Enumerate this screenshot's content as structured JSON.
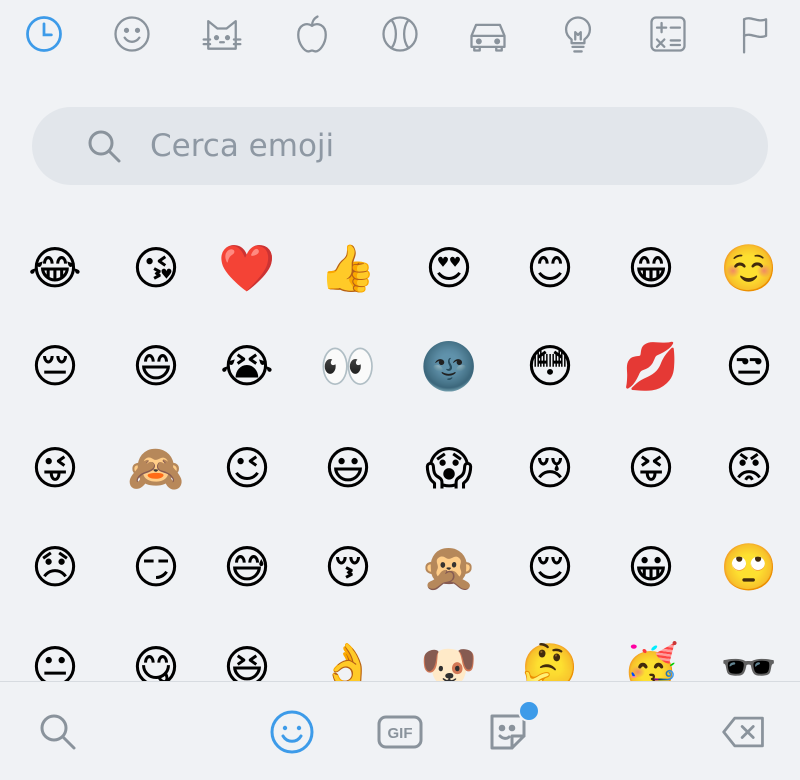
{
  "colors": {
    "accent": "#3d9be9",
    "icon_gray": "#8a939c",
    "search_bg": "#e2e6eb",
    "background": "#f0f2f5"
  },
  "categories": [
    {
      "icon": "clock-icon",
      "active": true
    },
    {
      "icon": "smiley-icon",
      "active": false
    },
    {
      "icon": "cat-icon",
      "active": false
    },
    {
      "icon": "apple-icon",
      "active": false
    },
    {
      "icon": "ball-icon",
      "active": false
    },
    {
      "icon": "car-icon",
      "active": false
    },
    {
      "icon": "lightbulb-icon",
      "active": false
    },
    {
      "icon": "symbols-icon",
      "active": false
    },
    {
      "icon": "flag-icon",
      "active": false
    }
  ],
  "search": {
    "placeholder": "Cerca emoji"
  },
  "emojis": [
    [
      "😂",
      "😘",
      "❤️",
      "👍",
      "😍",
      "😊",
      "😁",
      "☺️"
    ],
    [
      "😔",
      "😄",
      "😭",
      "👀",
      "🌚",
      "😳",
      "💋",
      "😒"
    ],
    [
      "😜",
      "🙈",
      "😉",
      "😃",
      "😱",
      "😢",
      "😝",
      "😡"
    ],
    [
      "😞",
      "😏",
      "😅",
      "😚",
      "🙊",
      "😌",
      "😀",
      "🙄"
    ],
    [
      "😐",
      "😋",
      "😆",
      "👌",
      "🐶",
      "🤔",
      "🥳",
      "🕶️"
    ]
  ],
  "bottom_bar": {
    "gif_label": "GIF",
    "items": [
      "search-icon",
      "emoji-icon",
      "gif-icon",
      "sticker-icon",
      "backspace-icon"
    ],
    "active": "emoji-icon"
  }
}
